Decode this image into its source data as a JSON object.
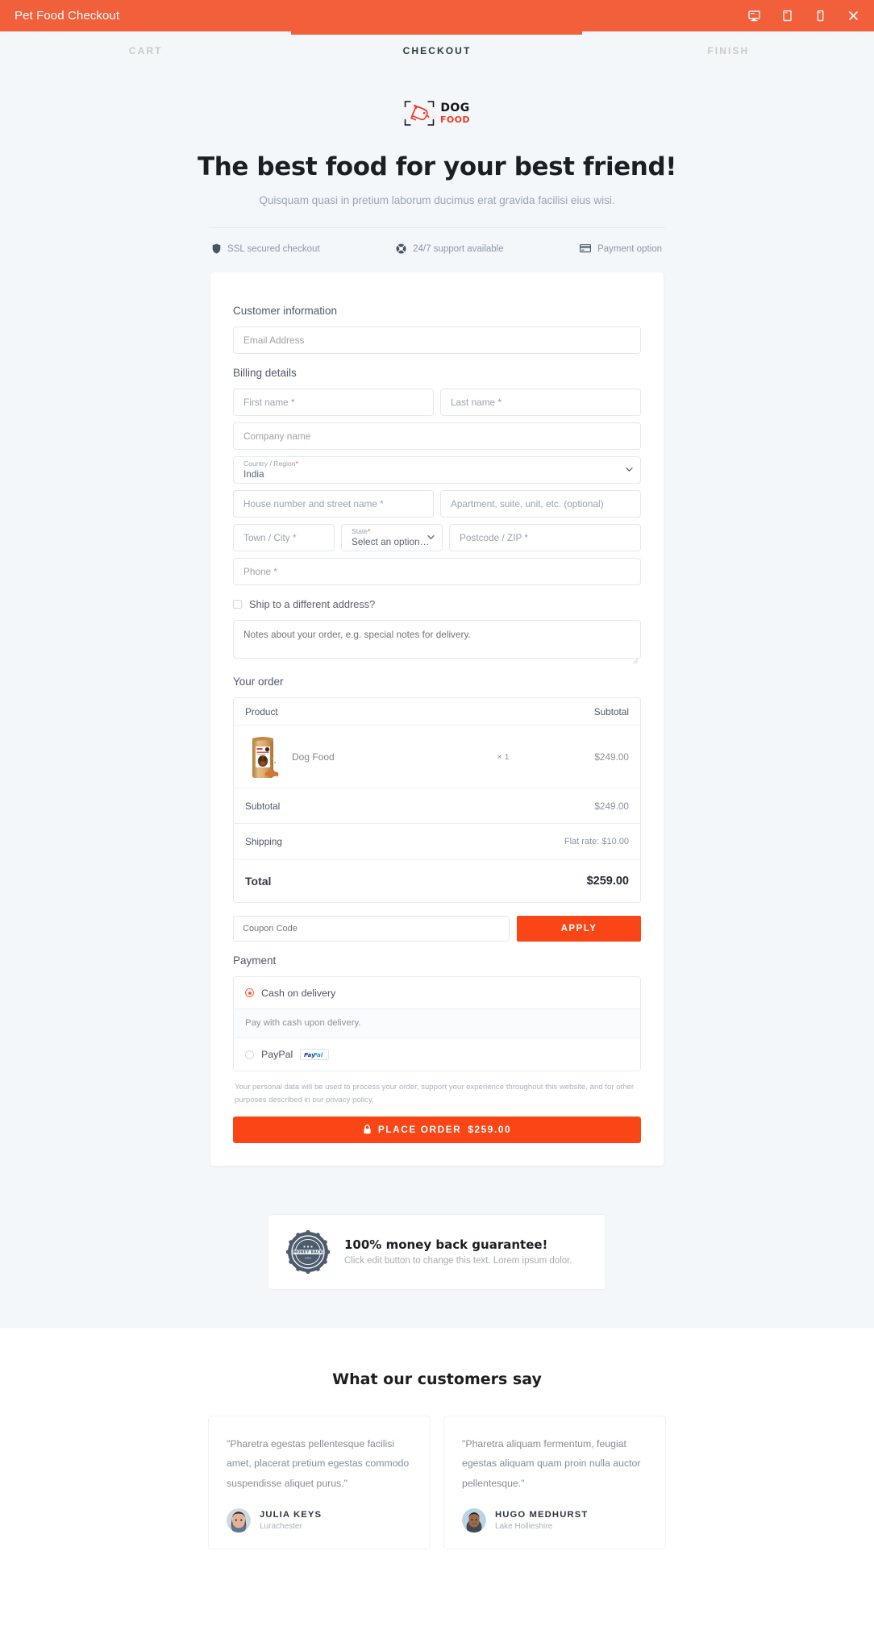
{
  "window": {
    "title": "Pet Food Checkout",
    "tools": [
      {
        "name": "desktop-preview-icon",
        "label": "Desktop"
      },
      {
        "name": "tablet-preview-icon",
        "label": "Tablet"
      },
      {
        "name": "mobile-preview-icon",
        "label": "Mobile"
      },
      {
        "name": "close-icon",
        "label": "Close"
      }
    ]
  },
  "steps": [
    {
      "label": "CART",
      "active": false
    },
    {
      "label": "CHECKOUT",
      "active": true
    },
    {
      "label": "FINISH",
      "active": false
    }
  ],
  "hero": {
    "logo_primary": "DOG",
    "logo_secondary": "FOOD",
    "heading": "The best food for your best friend!",
    "subheading": "Quisquam quasi in pretium laborum ducimus erat gravida facilisi eius wisi."
  },
  "trust": [
    {
      "icon": "shield-icon",
      "label": "SSL secured checkout"
    },
    {
      "icon": "lifebuoy-icon",
      "label": "24/7 support available"
    },
    {
      "icon": "credit-card-icon",
      "label": "Payment option"
    }
  ],
  "customer": {
    "section_title": "Customer information",
    "email_placeholder": "Email Address",
    "email_value": ""
  },
  "billing": {
    "section_title": "Billing details",
    "first_name_placeholder": "First name *",
    "last_name_placeholder": "Last name *",
    "company_placeholder": "Company name",
    "country_label": "Country / Region",
    "country_value": "India",
    "street_placeholder": "House number and street name *",
    "apartment_placeholder": "Apartment, suite, unit, etc. (optional)",
    "city_placeholder": "Town / City *",
    "state_label": "State",
    "state_value": "Select an option…",
    "postcode_placeholder": "Postcode / ZIP *",
    "phone_placeholder": "Phone *",
    "ship_different_label": "Ship to a different address?",
    "notes_placeholder": "Notes about your order, e.g. special notes for delivery."
  },
  "order": {
    "section_title": "Your order",
    "col_product": "Product",
    "col_subtotal": "Subtotal",
    "items": [
      {
        "name": "Dog Food",
        "qty": "× 1",
        "amount": "$249.00",
        "thumb": "dog-food-pouch"
      }
    ],
    "subtotal_label": "Subtotal",
    "subtotal_value": "$249.00",
    "shipping_label": "Shipping",
    "shipping_value": "Flat rate: $10.00",
    "total_label": "Total",
    "total_value": "$259.00"
  },
  "coupon": {
    "placeholder": "Coupon Code",
    "value": "",
    "apply_label": "APPLY"
  },
  "payment": {
    "section_title": "Payment",
    "options": [
      {
        "label": "Cash on delivery",
        "selected": true,
        "description": "Pay with cash upon delivery.",
        "badge": ""
      },
      {
        "label": "PayPal",
        "selected": false,
        "description": "",
        "badge": "PayPal"
      }
    ],
    "privacy_text": "Your personal data will be used to process your order, support your experience throughout this website, and for other purposes described in our privacy policy.",
    "place_order_label": "PLACE ORDER",
    "place_order_amount": "$259.00"
  },
  "guarantee": {
    "badge_text": "MONEY BACK",
    "title": "100% money back guarantee!",
    "text": "Click edit button to change this text. Lorem ipsum dolor."
  },
  "testimonials": {
    "heading": "What our customers say",
    "items": [
      {
        "quote": "\"Pharetra egestas pellentesque facilisi amet, placerat pretium egestas commodo suspendisse aliquet purus.\"",
        "name": "JULIA KEYS",
        "location": "Lurachester"
      },
      {
        "quote": "\"Pharetra aliquam fermentum, feugiat egestas aliquam quam proin nulla auctor pellentesque.\"",
        "name": "HUGO MEDHURST",
        "location": "Lake Hollieshire"
      }
    ]
  },
  "colors": {
    "header_orange": "#f1603a",
    "accent_orange": "#fa4616",
    "page_bg": "#f4f7fa",
    "card_bg": "#ffffff",
    "border": "#e4e8ed",
    "muted_text": "#9aa3ae"
  }
}
